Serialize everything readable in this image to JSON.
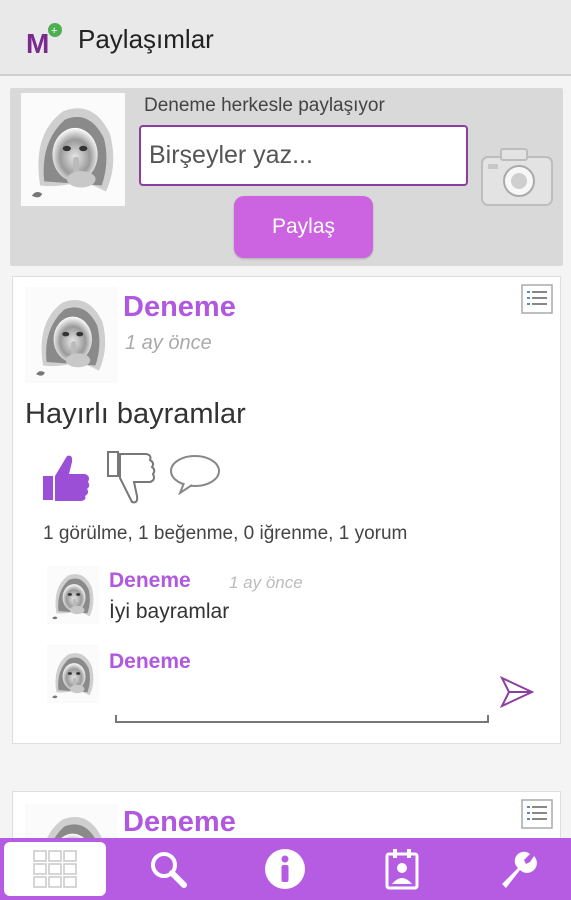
{
  "app": {
    "title": "Paylaşımlar",
    "accent_color": "#b65ce3",
    "author_color": "#b158e0"
  },
  "compose": {
    "hint": "Deneme herkesle paylaşıyor",
    "placeholder": "Birşeyler yaz...",
    "share_label": "Paylaş",
    "camera_icon": "camera-icon"
  },
  "post": {
    "author": "Deneme",
    "time": "1 ay  önce",
    "text": "Hayırlı bayramlar",
    "stats": "1 görülme, 1 beğenme, 0 iğrenme, 1 yorum",
    "comments": [
      {
        "author": "Deneme",
        "time": "1 ay  önce",
        "text": "İyi bayramlar"
      }
    ],
    "reply": {
      "author": "Deneme",
      "value": ""
    }
  },
  "post2": {
    "author": "Deneme"
  },
  "nav": {
    "items": [
      {
        "icon": "grid-icon",
        "active": true
      },
      {
        "icon": "search-icon",
        "active": false
      },
      {
        "icon": "info-icon",
        "active": false
      },
      {
        "icon": "contacts-icon",
        "active": false
      },
      {
        "icon": "wrench-icon",
        "active": false
      }
    ]
  }
}
